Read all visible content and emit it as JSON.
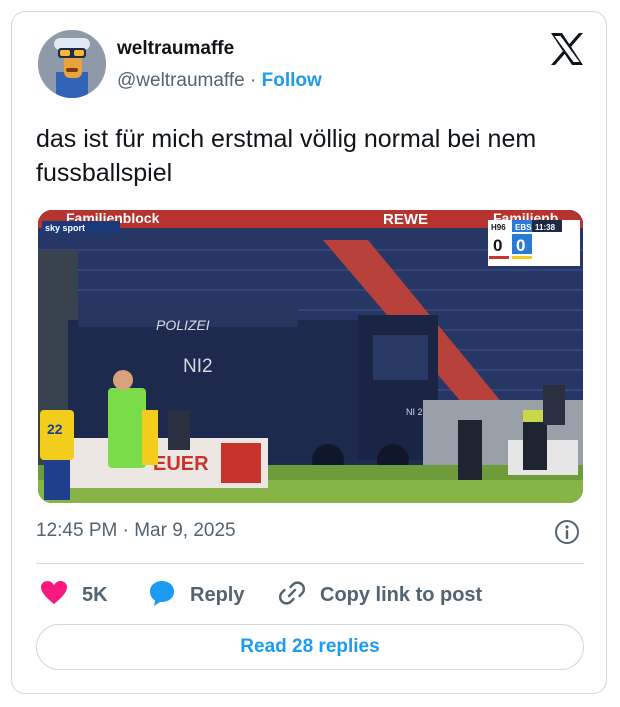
{
  "author": {
    "display_name": "weltraumaffe",
    "handle": "@weltraumaffe",
    "separator": "·",
    "follow_label": "Follow"
  },
  "tweet": {
    "text": "das ist für mich erstmal völlig normal bei nem fussballspiel",
    "timestamp": "12:45 PM · Mar 9, 2025"
  },
  "media": {
    "broadcast_logo": "sky sport",
    "banner_left": "Familienblock",
    "banner_center": "REWE",
    "banner_right": "Familienb",
    "vehicle_label": "POLIZEI",
    "vehicle_number": "NI2",
    "vehicle_number_side": "NI 2",
    "player_number": "22",
    "ad_board": "EUER",
    "scoreboard": {
      "home_team": "H96",
      "away_team": "EBS",
      "clock": "11:38",
      "home_score": "0",
      "away_score": "0"
    }
  },
  "actions": {
    "like_count": "5K",
    "reply_label": "Reply",
    "copy_label": "Copy link to post"
  },
  "read_replies_label": "Read 28 replies",
  "colors": {
    "like": "#f91880",
    "link": "#1d9bf0",
    "secondary_text": "#536471",
    "border": "#cfd9de"
  },
  "icons": [
    "x-logo-icon",
    "info-icon",
    "heart-icon",
    "reply-bubble-icon",
    "link-icon"
  ]
}
